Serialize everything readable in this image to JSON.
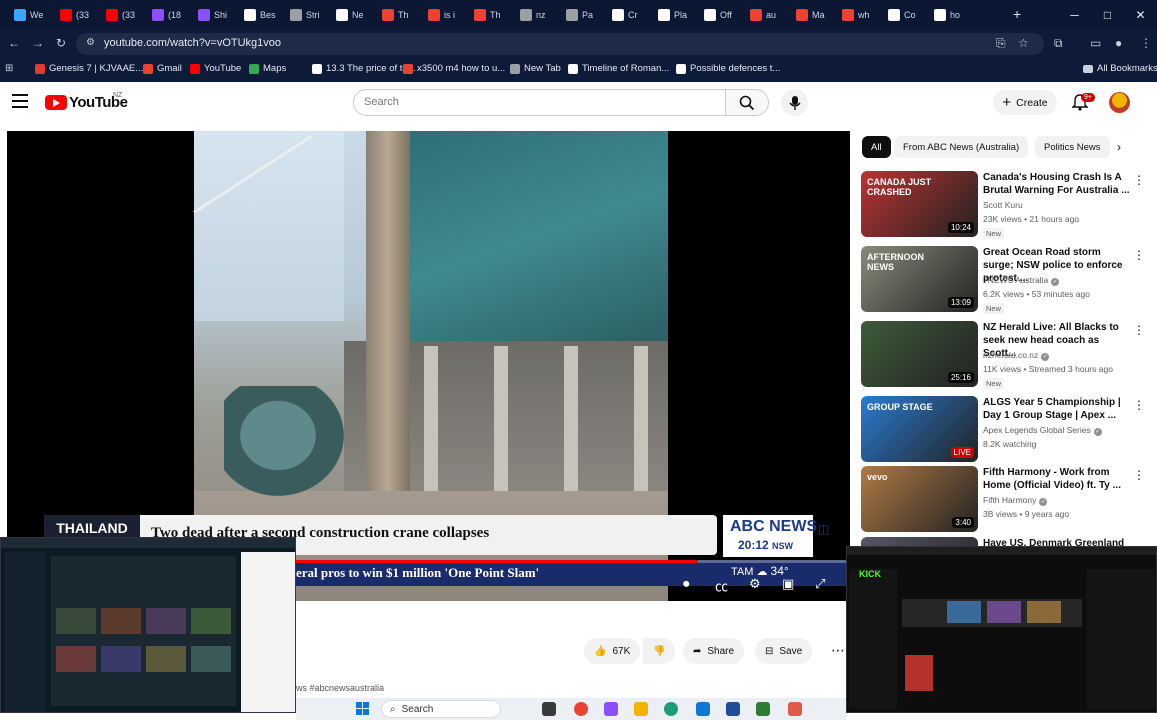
{
  "browser": {
    "tabs": [
      {
        "label": "We",
        "color": "#3ea6ff"
      },
      {
        "label": "(33",
        "color": "#ff0000"
      },
      {
        "label": "(33",
        "color": "#ff0000"
      },
      {
        "label": "(18",
        "color": "#8a4fff"
      },
      {
        "label": "Shi",
        "color": "#8a4fff"
      },
      {
        "label": "Bes",
        "color": "#ffffff"
      },
      {
        "label": "Stri",
        "color": "#9aa0a6"
      },
      {
        "label": "Ne",
        "color": "#ffffff"
      },
      {
        "label": "Th",
        "color": "#ea4335"
      },
      {
        "label": "is i",
        "color": "#ea4335"
      },
      {
        "label": "Th",
        "color": "#ea4335"
      },
      {
        "label": "nz",
        "color": "#9aa0a6"
      },
      {
        "label": "Pa",
        "color": "#9aa0a6"
      },
      {
        "label": "Cr",
        "color": "#ffffff"
      },
      {
        "label": "Pla",
        "color": "#ffffff"
      },
      {
        "label": "Off",
        "color": "#ffffff"
      },
      {
        "label": "au",
        "color": "#ea4335"
      },
      {
        "label": "Ma",
        "color": "#ea4335"
      },
      {
        "label": "wh",
        "color": "#ea4335"
      },
      {
        "label": "Co",
        "color": "#ffffff"
      },
      {
        "label": "ho",
        "color": "#ffffff"
      }
    ],
    "url": "youtube.com/watch?v=vOTUkg1voo",
    "bookmarks": [
      {
        "label": "Genesis 7 | KJVAAE...",
        "color": "#e53935"
      },
      {
        "label": "Gmail",
        "color": "#ea4335"
      },
      {
        "label": "YouTube",
        "color": "#ff0000"
      },
      {
        "label": "Maps",
        "color": "#34a853"
      },
      {
        "label": "13.3 The price of to...",
        "color": "#ffffff"
      },
      {
        "label": "x3500 m4 how to u...",
        "color": "#ea4335"
      },
      {
        "label": "New Tab",
        "color": "#9aa0a6"
      },
      {
        "label": "Timeline of Roman...",
        "color": "#ffffff"
      },
      {
        "label": "Possible defences t...",
        "color": "#ffffff"
      }
    ],
    "all_bookmarks": "All Bookmarks"
  },
  "youtube": {
    "logo_text": "YouTube",
    "region": "NZ",
    "search_placeholder": "Search",
    "create_label": "Create",
    "notif_count": "9+"
  },
  "video": {
    "lower_third_country": "THAILAND",
    "headline": "Two dead after a second construction crane collapses",
    "channel_brand": "ABC NEWS",
    "time": "20:12",
    "timezone": "NSW",
    "ticker": "eral pros to win $1 million 'One Point Slam'",
    "weather": "TAM",
    "temperature": "34°",
    "progress": 0.73
  },
  "actions": {
    "likes": "67K",
    "share": "Share",
    "save": "Save",
    "hashtag": "ws #abcnewsaustralia"
  },
  "chips": [
    "All",
    "From ABC News (Australia)",
    "Politics News"
  ],
  "recommendations": [
    {
      "title": "Canada's Housing Crash Is A Brutal Warning For Australia ...",
      "channel": "Scott Kuru",
      "meta": "23K views • 21 hours ago",
      "badge": "New",
      "duration": "10:24",
      "verified": false,
      "thumb": "#b33",
      "thumb_text": "CANADA JUST CRASHED"
    },
    {
      "title": "Great Ocean Road storm surge; NSW police to enforce protest ...",
      "channel": "7NEWS Australia",
      "meta": "6.2K views • 53 minutes ago",
      "badge": "New",
      "duration": "13:09",
      "verified": true,
      "thumb": "#8a8a7a",
      "thumb_text": "AFTERNOON NEWS"
    },
    {
      "title": "NZ Herald Live: All Blacks to seek new head coach as Scott...",
      "channel": "nzherald.co.nz",
      "meta": "11K views • Streamed 3 hours ago",
      "badge": "New",
      "duration": "25:16",
      "verified": true,
      "thumb": "#3e5a3a",
      "thumb_text": ""
    },
    {
      "title": "ALGS Year 5 Championship | Day 1 Group Stage | Apex ...",
      "channel": "Apex Legends Global Series",
      "meta": "8.2K watching",
      "badge": "",
      "duration": "LIVE",
      "verified": true,
      "thumb": "#2a7bd0",
      "thumb_text": "GROUP STAGE"
    },
    {
      "title": "Fifth Harmony - Work from Home (Official Video) ft. Ty ...",
      "channel": "Fifth Harmony",
      "meta": "3B views • 9 years ago",
      "badge": "",
      "duration": "3:40",
      "verified": true,
      "thumb": "#b07a45",
      "thumb_text": "vevo"
    },
    {
      "title": "Have US, Denmark Greenland",
      "channel": "",
      "meta": "",
      "badge": "",
      "duration": "",
      "verified": false,
      "thumb": "#556",
      "thumb_text": ""
    }
  ],
  "taskbar": {
    "search_label": "Search"
  },
  "colors": {
    "yt_red": "#ff0000",
    "chrome_bg": "#0d1a38",
    "abc_blue": "#1b3a8c"
  }
}
